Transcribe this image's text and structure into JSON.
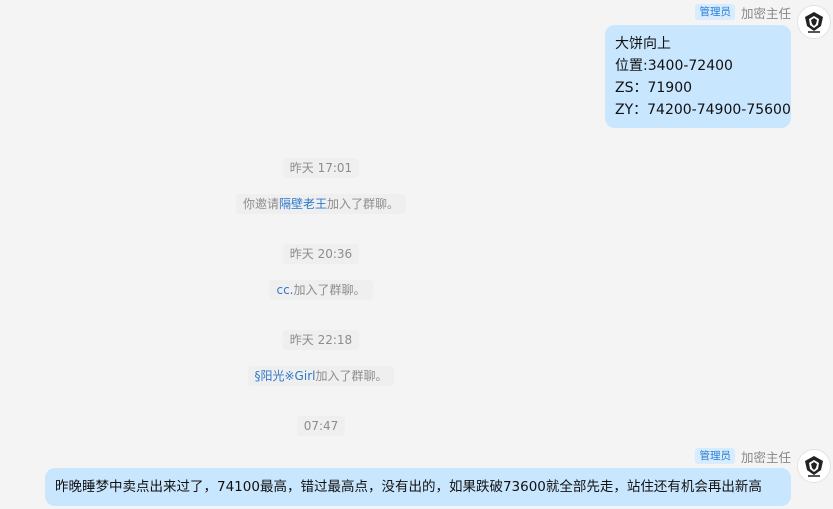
{
  "messages": {
    "top": {
      "role": "管理员",
      "sender": "加密主任",
      "lines": [
        "大饼向上",
        "位置:3400-72400",
        "ZS：71900",
        "ZY：74200-74900-75600"
      ]
    },
    "system": [
      {
        "time": "昨天 17:01"
      },
      {
        "pre": "你邀请",
        "name": "隔壁老王",
        "post": "加入了群聊。"
      },
      {
        "time": "昨天 20:36"
      },
      {
        "name": "cc.",
        "post": "加入了群聊。"
      },
      {
        "time": "昨天 22:18"
      },
      {
        "name": "§阳光※Girl",
        "post": "加入了群聊。"
      },
      {
        "time": "07:47"
      }
    ],
    "bottom": {
      "role": "管理员",
      "sender": "加密主任",
      "text": "昨晚睡梦中卖点出来过了，74100最高，错过最高点，没有出的，如果跌破73600就全部先走，站住还有机会再出新高"
    }
  },
  "colors": {
    "bubble": "#c9e6ff",
    "badge_bg": "#d7ecff",
    "link": "#2f78c9",
    "background": "#f4f4f4"
  },
  "icons": {
    "avatar": "group-logo-icon"
  }
}
